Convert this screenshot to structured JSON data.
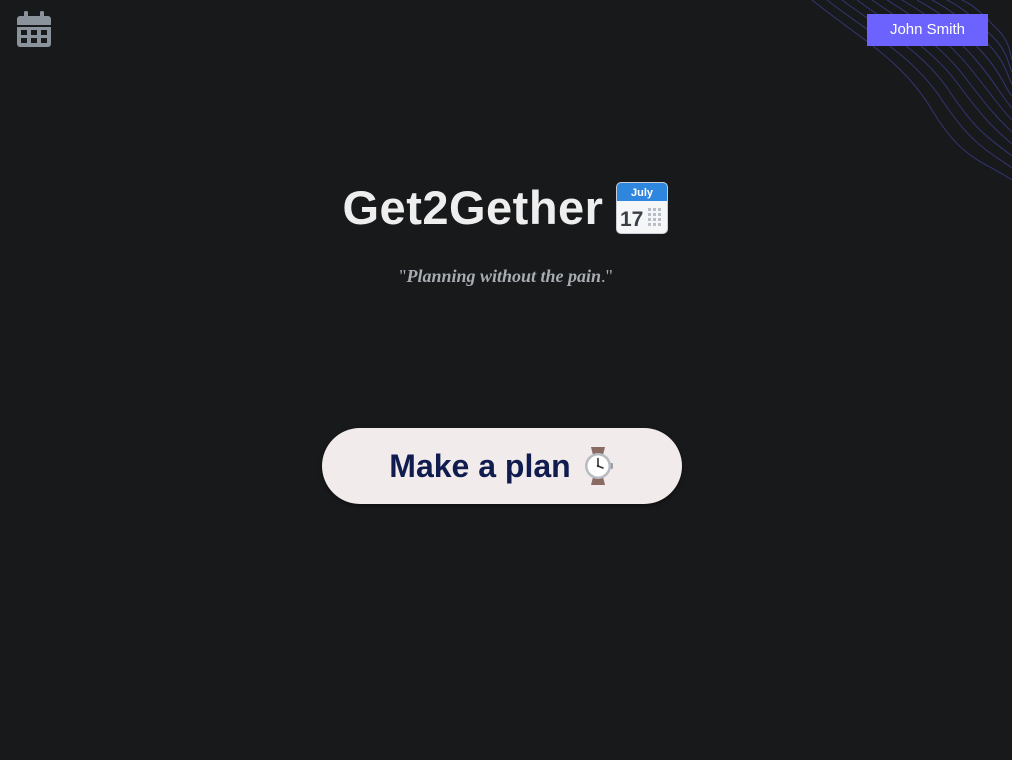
{
  "header": {
    "home_icon": "calendar-icon",
    "user_name": "John Smith"
  },
  "hero": {
    "title": "Get2Gether",
    "title_emoji": "calendar-emoji-icon",
    "calendar_month": "July",
    "calendar_day": "17",
    "tagline_open_quote": "\"",
    "tagline_text": "Planning without the pain",
    "tagline_close": ".\""
  },
  "cta": {
    "label": "Make a plan",
    "icon": "watch-icon"
  },
  "colors": {
    "background": "#18191b",
    "accent": "#6c63ff",
    "button_bg": "#f2ebeb",
    "button_text": "#0f1c4d",
    "title": "#eeeeee",
    "tagline": "#a7acb2"
  }
}
